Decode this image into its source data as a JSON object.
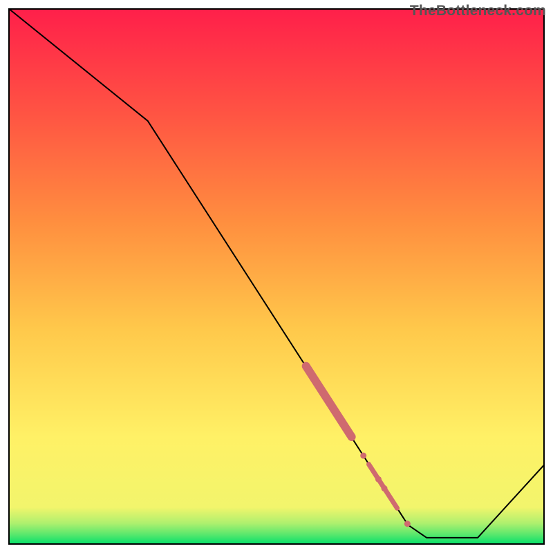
{
  "chart_data": {
    "type": "line",
    "title": "",
    "xlabel": "",
    "ylabel": "",
    "xlim": [
      0,
      1
    ],
    "ylim": [
      0,
      1
    ],
    "watermark": "TheBottleneck.com",
    "gradient_stops": [
      {
        "offset": 0.0,
        "color": "#00e06a"
      },
      {
        "offset": 0.02,
        "color": "#5de86d"
      },
      {
        "offset": 0.04,
        "color": "#aef06e"
      },
      {
        "offset": 0.07,
        "color": "#f2f56c"
      },
      {
        "offset": 0.2,
        "color": "#fff166"
      },
      {
        "offset": 0.4,
        "color": "#ffc94b"
      },
      {
        "offset": 0.6,
        "color": "#ff8f3f"
      },
      {
        "offset": 0.8,
        "color": "#ff5543"
      },
      {
        "offset": 1.0,
        "color": "#ff1f4a"
      }
    ],
    "series": [
      {
        "name": "curve",
        "color": "#000000",
        "width": 2,
        "points": [
          {
            "x": 0.0,
            "y": 1.0
          },
          {
            "x": 0.26,
            "y": 0.79
          },
          {
            "x": 0.745,
            "y": 0.037
          },
          {
            "x": 0.78,
            "y": 0.013
          },
          {
            "x": 0.875,
            "y": 0.013
          },
          {
            "x": 1.0,
            "y": 0.15
          }
        ]
      }
    ],
    "highlight": {
      "color": "#cf6a6f",
      "thick_segments": [
        {
          "x0": 0.555,
          "y0": 0.333,
          "x1": 0.64,
          "y1": 0.201,
          "w": 12
        }
      ],
      "dots": [
        {
          "x": 0.662,
          "y": 0.166,
          "r": 4.5
        },
        {
          "x": 0.69,
          "y": 0.122,
          "r": 4.5
        },
        {
          "x": 0.701,
          "y": 0.105,
          "r": 4.5
        },
        {
          "x": 0.744,
          "y": 0.039,
          "r": 4.5
        }
      ],
      "thin_segment": {
        "x0": 0.672,
        "y0": 0.15,
        "x1": 0.725,
        "y1": 0.068,
        "w": 7
      }
    }
  }
}
